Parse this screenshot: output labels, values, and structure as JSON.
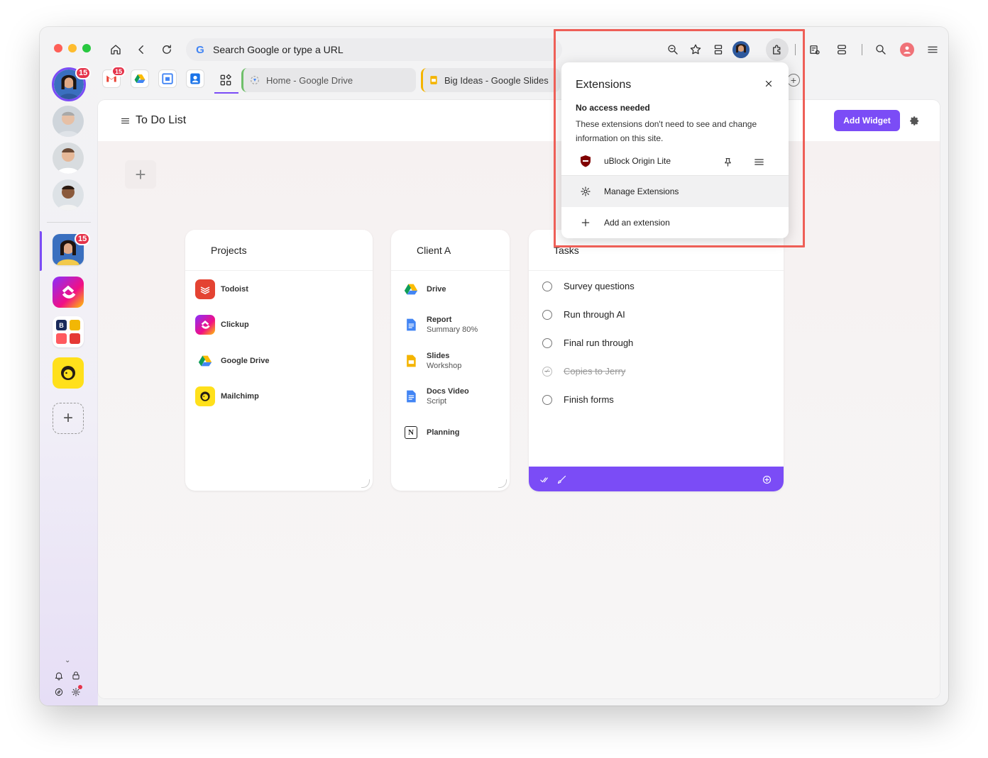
{
  "toolbar": {
    "search_placeholder": "Search Google or type a URL"
  },
  "tabs": {
    "gmail_badge": "15",
    "drive_tab_label": "Home - Google Drive",
    "slides_tab_label": "Big Ideas - Google Slides"
  },
  "rail": {
    "main_avatar_badge": "15",
    "space_avatar_badge": "15"
  },
  "page": {
    "title": "To Do List",
    "add_widget_label": "Add Widget"
  },
  "widgets": {
    "projects": {
      "title": "Projects",
      "items": [
        {
          "label": "Todoist",
          "icon": "todoist-icon"
        },
        {
          "label": "Clickup",
          "icon": "clickup-icon"
        },
        {
          "label": "Google Drive",
          "icon": "google-drive-icon"
        },
        {
          "label": "Mailchimp",
          "icon": "mailchimp-icon"
        }
      ]
    },
    "client_a": {
      "title": "Client A",
      "items": [
        {
          "label": "Drive",
          "sub": ""
        },
        {
          "label": "Report",
          "sub": "Summary 80%"
        },
        {
          "label": "Slides",
          "sub": "Workshop"
        },
        {
          "label": "Docs Video",
          "sub": "Script"
        },
        {
          "label": "Planning",
          "sub": ""
        }
      ]
    },
    "tasks": {
      "title": "Tasks",
      "items": [
        {
          "label": "Survey questions",
          "done": false
        },
        {
          "label": "Run through AI",
          "done": false
        },
        {
          "label": "Final run through",
          "done": false
        },
        {
          "label": "Copies to Jerry",
          "done": true
        },
        {
          "label": "Finish forms",
          "done": false
        }
      ]
    }
  },
  "extensions_popup": {
    "title": "Extensions",
    "section_heading": "No access needed",
    "section_desc": "These extensions don't need to see and change information on this site.",
    "extension_name": "uBlock Origin Lite",
    "manage_label": "Manage Extensions",
    "add_label": "Add an extension"
  },
  "colors": {
    "accent_purple": "#7b4cf6",
    "highlight_red": "#ee5f57",
    "badge_red": "#e5334a"
  }
}
